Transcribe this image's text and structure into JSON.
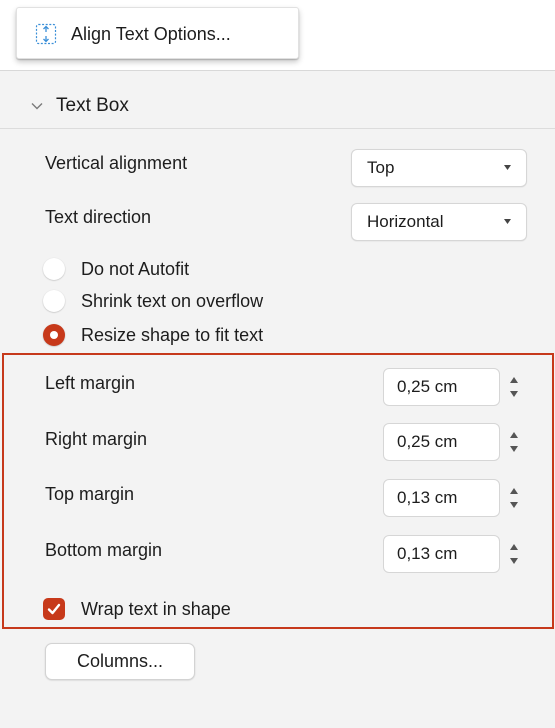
{
  "menu": {
    "align_text_options": "Align Text Options...",
    "icon": "align-text-icon"
  },
  "text_box": {
    "title": "Text Box",
    "vertical_alignment": {
      "label": "Vertical alignment",
      "value": "Top"
    },
    "text_direction": {
      "label": "Text direction",
      "value": "Horizontal"
    },
    "autofit": [
      {
        "label": "Do not Autofit",
        "selected": false
      },
      {
        "label": "Shrink text on overflow",
        "selected": false
      },
      {
        "label": "Resize shape to fit text",
        "selected": true
      }
    ],
    "margins": [
      {
        "label": "Left margin",
        "value": "0,25 cm"
      },
      {
        "label": "Right margin",
        "value": "0,25 cm"
      },
      {
        "label": "Top margin",
        "value": "0,13 cm"
      },
      {
        "label": "Bottom margin",
        "value": "0,13 cm"
      }
    ],
    "wrap_text": {
      "label": "Wrap text in shape",
      "checked": true
    },
    "columns_button": "Columns..."
  },
  "colors": {
    "accent": "#c7391a",
    "highlight_border": "#c6391b",
    "panel_bg": "#f3f3f3",
    "icon_blue": "#3a8fd8"
  }
}
